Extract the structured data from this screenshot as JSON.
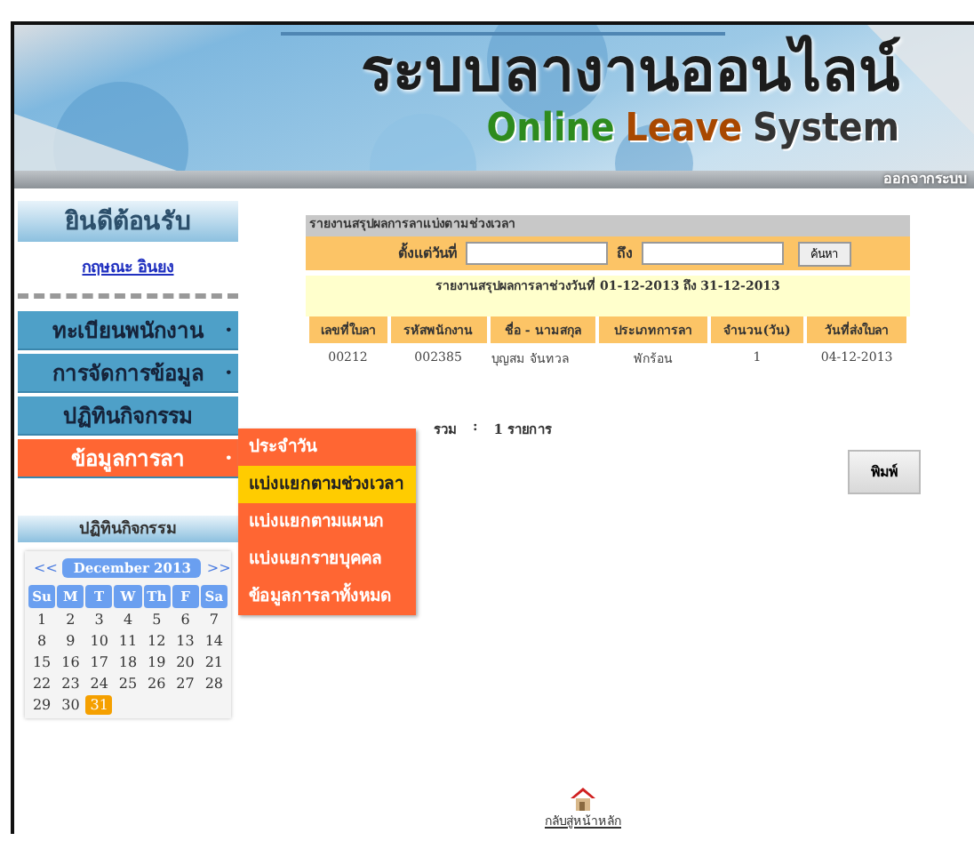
{
  "header": {
    "title_thai": "ระบบลางานออนไลน์",
    "title_words": [
      {
        "text": "Online",
        "color": "#2e8b1e"
      },
      {
        "text": "Leave",
        "color": "#a84800"
      },
      {
        "text": "System",
        "color": "#333333"
      }
    ],
    "logout": "ออกจากระบบ"
  },
  "sidebar": {
    "welcome": "ยินดีต้อนรับ",
    "user": "กฤษณะ อินยง",
    "menu": [
      {
        "label": "ทะเบียนพนักงาน",
        "arrow": "•",
        "selected": false
      },
      {
        "label": "การจัดการข้อมูล",
        "arrow": "•",
        "selected": false
      },
      {
        "label": "ปฏิทินกิจกรรม",
        "selected": false
      },
      {
        "label": "ข้อมูลการลา",
        "arrow": "•",
        "selected": true
      }
    ],
    "submenu": [
      {
        "label": "ประจำวัน",
        "selected": false
      },
      {
        "label": "แบ่งแยกตามช่วงเวลา",
        "selected": true
      },
      {
        "label": "แบ่งแยกตามแผนก",
        "selected": false
      },
      {
        "label": "แบ่งแยกรายบุคคล",
        "selected": false
      },
      {
        "label": "ข้อมูลการลาทั้งหมด",
        "selected": false
      }
    ]
  },
  "calendar": {
    "heading": "ปฏิทินกิจกรรม",
    "prev": "<<",
    "month": "December 2013",
    "next": ">>",
    "weekdays": [
      "Su",
      "M",
      "T",
      "W",
      "Th",
      "F",
      "Sa"
    ],
    "days": [
      {
        "d": "1",
        "selected": false
      },
      {
        "d": "2",
        "selected": false
      },
      {
        "d": "3",
        "selected": false
      },
      {
        "d": "4",
        "selected": false
      },
      {
        "d": "5",
        "selected": false
      },
      {
        "d": "6",
        "selected": false
      },
      {
        "d": "7",
        "selected": false
      },
      {
        "d": "8",
        "selected": false
      },
      {
        "d": "9",
        "selected": false
      },
      {
        "d": "10",
        "selected": false
      },
      {
        "d": "11",
        "selected": false
      },
      {
        "d": "12",
        "selected": false
      },
      {
        "d": "13",
        "selected": false
      },
      {
        "d": "14",
        "selected": false
      },
      {
        "d": "15",
        "selected": false
      },
      {
        "d": "16",
        "selected": false
      },
      {
        "d": "17",
        "selected": false
      },
      {
        "d": "18",
        "selected": false
      },
      {
        "d": "19",
        "selected": false
      },
      {
        "d": "20",
        "selected": false
      },
      {
        "d": "21",
        "selected": false
      },
      {
        "d": "22",
        "selected": false
      },
      {
        "d": "23",
        "selected": false
      },
      {
        "d": "24",
        "selected": false
      },
      {
        "d": "25",
        "selected": false
      },
      {
        "d": "26",
        "selected": false
      },
      {
        "d": "27",
        "selected": false
      },
      {
        "d": "28",
        "selected": false
      },
      {
        "d": "29",
        "selected": false
      },
      {
        "d": "30",
        "selected": false
      },
      {
        "d": "31",
        "selected": true
      }
    ]
  },
  "report": {
    "title": "รายงานสรุปผลการลาแบ่งตามช่วงเวลา",
    "from_label": "ตั้งแต่วันที่",
    "to_label": "ถึง",
    "search_button": "ค้นหา",
    "summary": "รายงานสรุปผลการลาช่วงวันที่ 01-12-2013 ถึง 31-12-2013",
    "columns": [
      "เลขที่ใบลา",
      "รหัสพนักงาน",
      "ชื่อ - นามสกุล",
      "ประเภทการลา",
      "จำนวน(วัน)",
      "วันที่ส่งใบลา"
    ],
    "rows": [
      [
        "00212",
        "002385",
        "บุญสม จันทวล",
        "พักร้อน",
        "1",
        "04-12-2013"
      ]
    ],
    "total_label": "รวม",
    "total_sep": ":",
    "total": "1 รายการ",
    "print_button": "พิมพ์"
  },
  "footer": {
    "home": "กลับสู่หน้าหลัก"
  }
}
